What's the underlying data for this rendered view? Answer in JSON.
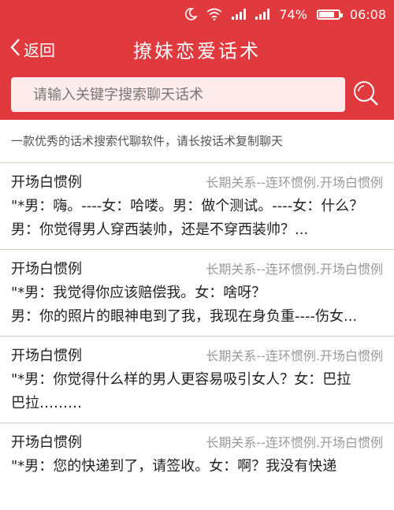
{
  "status_bar": {
    "moon_icon": "moon-icon",
    "wifi_icon": "wifi-icon",
    "battery_percent": "74%",
    "time": "06:08"
  },
  "header": {
    "back_label": "返回",
    "title": "撩妹恋爱话术"
  },
  "search": {
    "placeholder": "请输入关键字搜索聊天话术"
  },
  "tagline": "一款优秀的话术搜索代聊软件，请长按话术复制聊天",
  "colors": {
    "brand_red": "#e03a3e",
    "search_bg": "#fdeceb",
    "divider": "#d9c9c0"
  },
  "results": [
    {
      "type": "开场白惯例",
      "category": "长期关系--连环惯例.开场白惯例",
      "line1": "\"*男：嗨。----女：哈喽。男：做个测试。----女：什么？",
      "line2": "男：你觉得男人穿西装帅，还是不穿西装帅？..."
    },
    {
      "type": "开场白惯例",
      "category": "长期关系--连环惯例.开场白惯例",
      "line1": "\"*男：我觉得你应该赔偿我。女：啥呀？",
      "line2": "男：你的照片的眼神电到了我，我现在身负重----伤女..."
    },
    {
      "type": "开场白惯例",
      "category": "长期关系--连环惯例.开场白惯例",
      "line1": "\"*男：你觉得什么样的男人更容易吸引女人？女：巴拉",
      "line2": "巴拉………"
    },
    {
      "type": "开场白惯例",
      "category": "长期关系--连环惯例.开场白惯例",
      "line1": "\"*男：您的快递到了，请签收。女：啊？我没有快递",
      "line2": ""
    }
  ]
}
